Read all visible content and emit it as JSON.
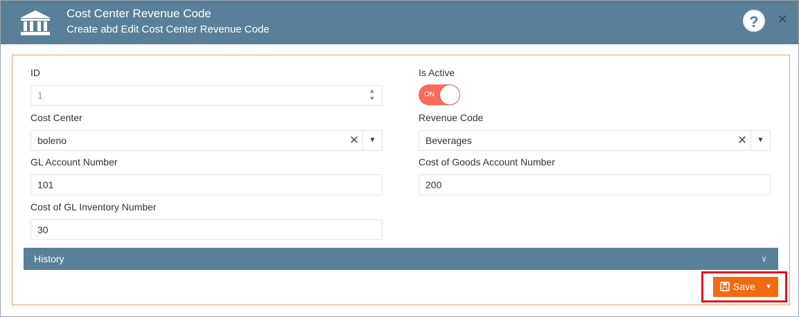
{
  "header": {
    "title": "Cost Center Revenue Code",
    "subtitle": "Create abd Edit Cost Center Revenue Code",
    "help_label": "?",
    "close_label": "✕"
  },
  "form": {
    "id": {
      "label": "ID",
      "value": "1"
    },
    "is_active": {
      "label": "Is Active",
      "toggle_text": "ON",
      "on": true
    },
    "cost_center": {
      "label": "Cost Center",
      "value": "boleno"
    },
    "revenue_code": {
      "label": "Revenue Code",
      "value": "Beverages"
    },
    "gl_account": {
      "label": "GL Account Number",
      "value": "101"
    },
    "cogs_account": {
      "label": "Cost of Goods Account Number",
      "value": "200"
    },
    "gl_inventory": {
      "label": "Cost of GL Inventory Number",
      "value": "30"
    }
  },
  "history": {
    "label": "History"
  },
  "actions": {
    "save_label": "Save"
  },
  "colors": {
    "header": "#5a8099",
    "accent": "#f26a10",
    "toggle_on": "#ff6a5a",
    "highlight": "#e8141b",
    "panel_border": "#f0a05c"
  },
  "icons": {
    "logo": "bank-icon",
    "help": "help-icon",
    "close": "close-icon",
    "clear": "clear-icon",
    "dropdown": "caret-down-icon",
    "chevron": "chevron-down-icon",
    "save": "floppy-disk-icon"
  }
}
